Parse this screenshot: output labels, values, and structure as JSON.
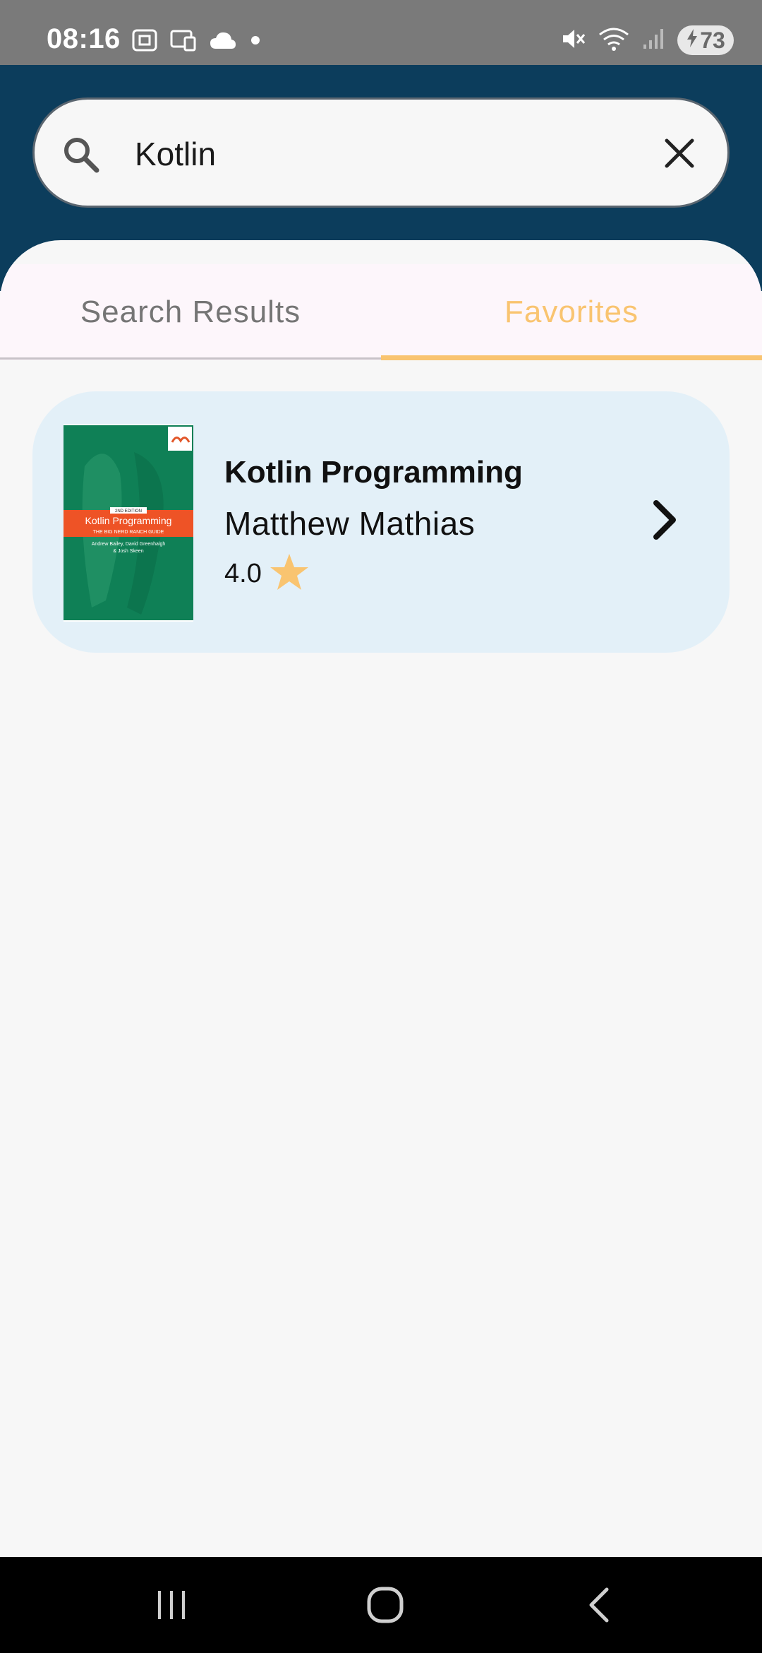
{
  "status_bar": {
    "time": "08:16",
    "battery": "73"
  },
  "search": {
    "query": "Kotlin",
    "icons": [
      "search-icon",
      "close-icon"
    ]
  },
  "tabs": [
    {
      "label": "Search Results",
      "selected": false
    },
    {
      "label": "Favorites",
      "selected": true
    }
  ],
  "book": {
    "title": "Kotlin Programming",
    "author": "Matthew Mathias",
    "rating": "4.0",
    "cover": {
      "edition": "2ND EDITION",
      "title": "Kotlin Programming",
      "subtitle": "THE BIG NERD RANCH GUIDE",
      "authors_line1": "Andrew Bailey, David Greenhalgh",
      "authors_line2": "& Josh Skeen"
    }
  },
  "colors": {
    "header": "#0c3d5c",
    "accent": "#f9c470",
    "card": "#e3f0f8"
  },
  "nav": [
    "recent-apps-icon",
    "home-icon",
    "back-icon"
  ]
}
